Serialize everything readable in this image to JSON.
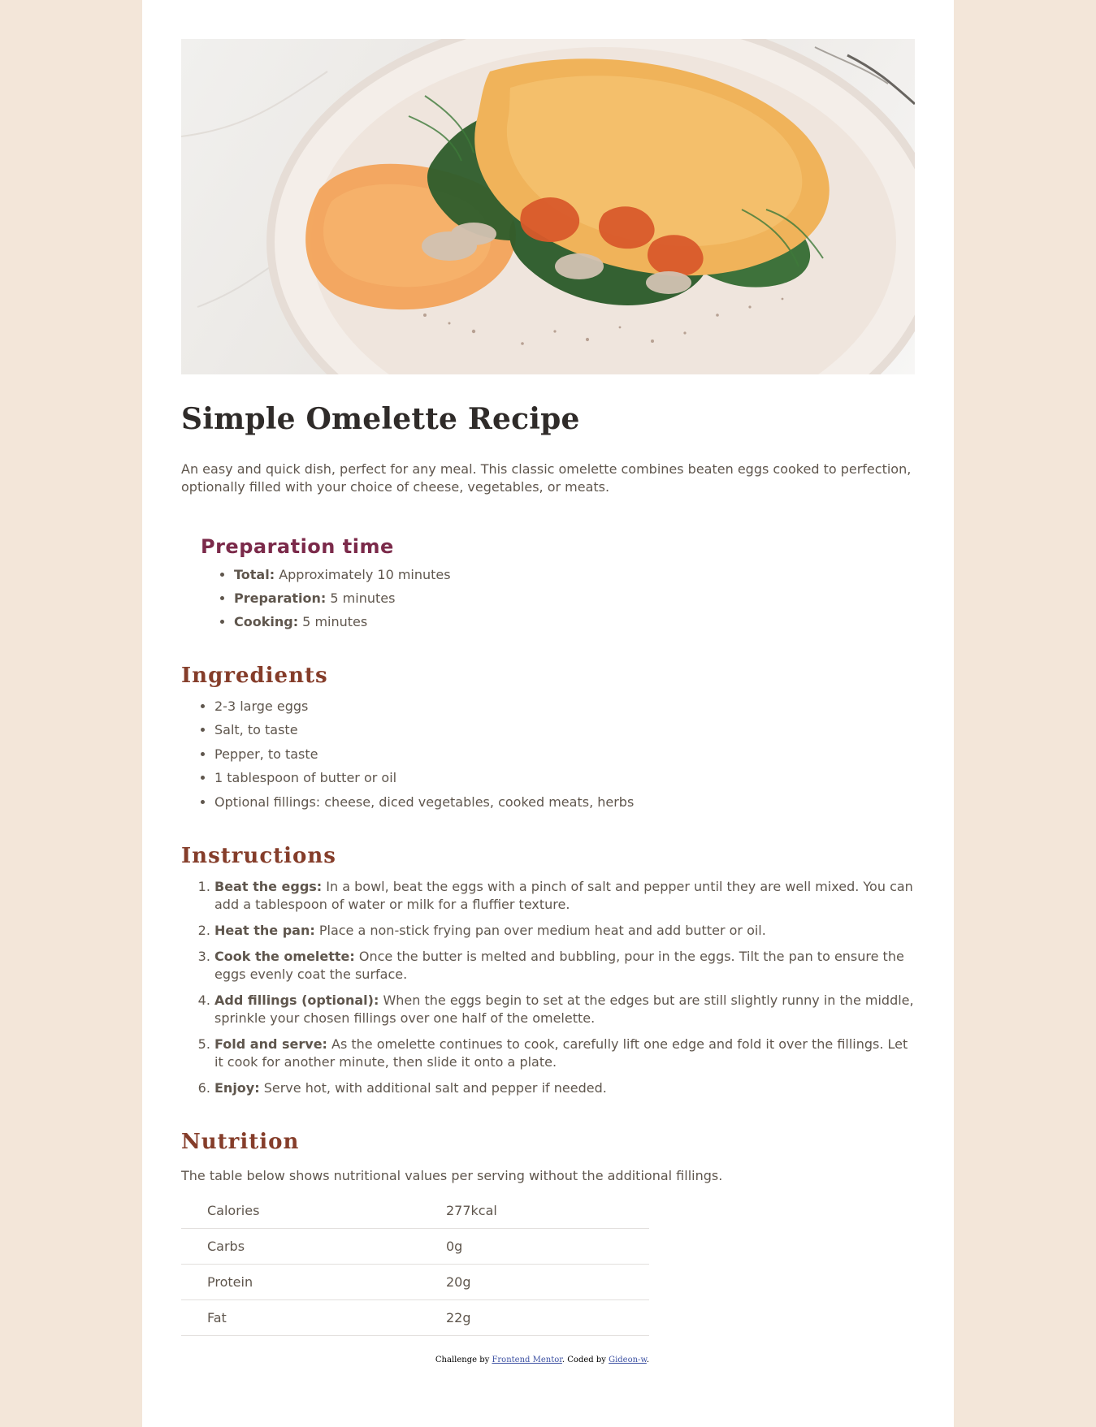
{
  "hero": {
    "alt": "Omelette plate"
  },
  "title": "Simple Omelette Recipe",
  "intro": "An easy and quick dish, perfect for any meal. This classic omelette combines beaten eggs cooked to perfection, optionally filled with your choice of cheese, vegetables, or meats.",
  "prep": {
    "heading": "Preparation time",
    "items": [
      {
        "label": "Total:",
        "text": " Approximately 10 minutes"
      },
      {
        "label": "Preparation:",
        "text": " 5 minutes"
      },
      {
        "label": "Cooking:",
        "text": " 5 minutes"
      }
    ]
  },
  "ingredients": {
    "heading": "Ingredients",
    "items": [
      "2-3 large eggs",
      "Salt, to taste",
      "Pepper, to taste",
      "1 tablespoon of butter or oil",
      "Optional fillings: cheese, diced vegetables, cooked meats, herbs"
    ]
  },
  "instructions": {
    "heading": "Instructions",
    "items": [
      {
        "label": "Beat the eggs:",
        "text": " In a bowl, beat the eggs with a pinch of salt and pepper until they are well mixed. You can add a tablespoon of water or milk for a fluffier texture."
      },
      {
        "label": "Heat the pan:",
        "text": " Place a non-stick frying pan over medium heat and add butter or oil."
      },
      {
        "label": "Cook the omelette:",
        "text": " Once the butter is melted and bubbling, pour in the eggs. Tilt the pan to ensure the eggs evenly coat the surface."
      },
      {
        "label": "Add fillings (optional):",
        "text": " When the eggs begin to set at the edges but are still slightly runny in the middle, sprinkle your chosen fillings over one half of the omelette."
      },
      {
        "label": "Fold and serve:",
        "text": " As the omelette continues to cook, carefully lift one edge and fold it over the fillings. Let it cook for another minute, then slide it onto a plate."
      },
      {
        "label": "Enjoy:",
        "text": " Serve hot, with additional salt and pepper if needed."
      }
    ]
  },
  "nutrition": {
    "heading": "Nutrition",
    "desc": "The table below shows nutritional values per serving without the additional fillings.",
    "rows": [
      {
        "name": "Calories",
        "value": "277kcal"
      },
      {
        "name": "Carbs",
        "value": "0g"
      },
      {
        "name": "Protein",
        "value": "20g"
      },
      {
        "name": "Fat",
        "value": "22g"
      }
    ]
  },
  "attribution": {
    "prefix": "Challenge by ",
    "link1": "Frontend Mentor",
    "middle": ". Coded by ",
    "link2": "Gideon-w",
    "suffix": "."
  },
  "colors": {
    "page_bg": "#F3E6D9",
    "card_bg": "#FFFFFF",
    "title": "#2F2B29",
    "body_text": "#5F564D",
    "prep_heading": "#7B2A4A",
    "section_heading": "#853D2A",
    "link": "#3E52A3"
  }
}
